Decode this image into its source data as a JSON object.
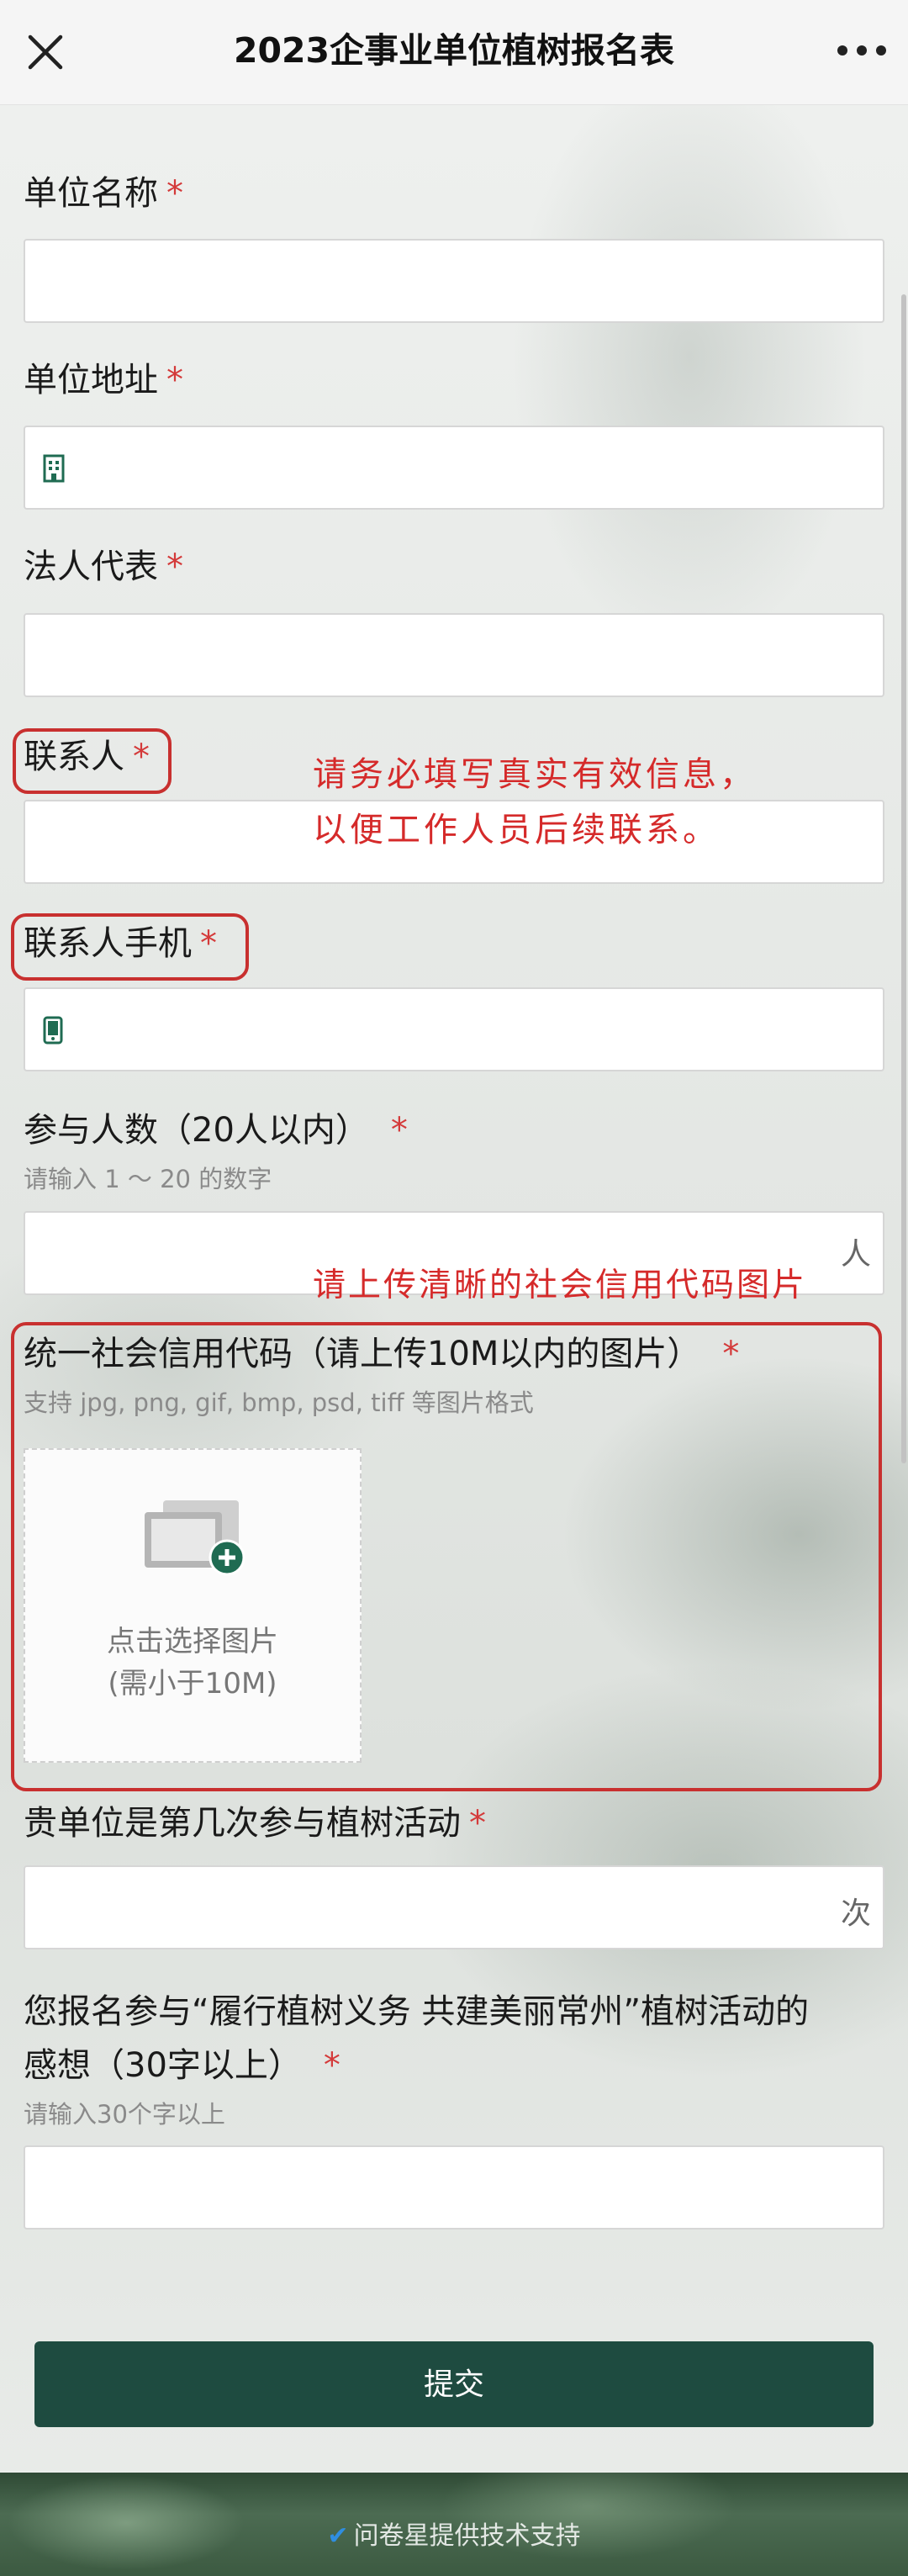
{
  "header": {
    "title": "2023企事业单位植树报名表"
  },
  "fields": [
    {
      "label": "单位名称",
      "required": "*"
    },
    {
      "label": "单位地址",
      "required": "*"
    },
    {
      "label": "法人代表",
      "required": "*"
    },
    {
      "label": "联系人",
      "required": "*"
    },
    {
      "label": "联系人手机",
      "required": "*"
    },
    {
      "label": "参与人数（20人以内）",
      "required": "*",
      "hint": "请输入 1 ～ 20 的数字",
      "unit": "人"
    },
    {
      "label": "统一社会信用代码（请上传10M以内的图片）",
      "required": "*",
      "hint": "支持 jpg, png, gif, bmp, psd, tiff 等图片格式"
    },
    {
      "label": "贵单位是第几次参与植树活动",
      "required": "*",
      "unit": "次"
    },
    {
      "label_line1": "您报名参与“履行植树义务 共建美丽常州”植树活动的",
      "label_line2": "感想（30字以上）",
      "required": "*",
      "hint": "请输入30个字以上"
    }
  ],
  "upload": {
    "line1": "点击选择图片",
    "line2": "(需小于10M)"
  },
  "annotations": {
    "contact_note_line1": "请务必填写真实有效信息，",
    "contact_note_line2": "以便工作人员后续联系。",
    "upload_note": "请上传清晰的社会信用代码图片"
  },
  "submit_label": "提交",
  "footer": {
    "text": "问卷星提供技术支持"
  },
  "colors": {
    "required": "#d43a3a",
    "annotation": "#d52a2a",
    "submit_bg": "#1e4b40",
    "icon_green": "#1f6b52"
  }
}
